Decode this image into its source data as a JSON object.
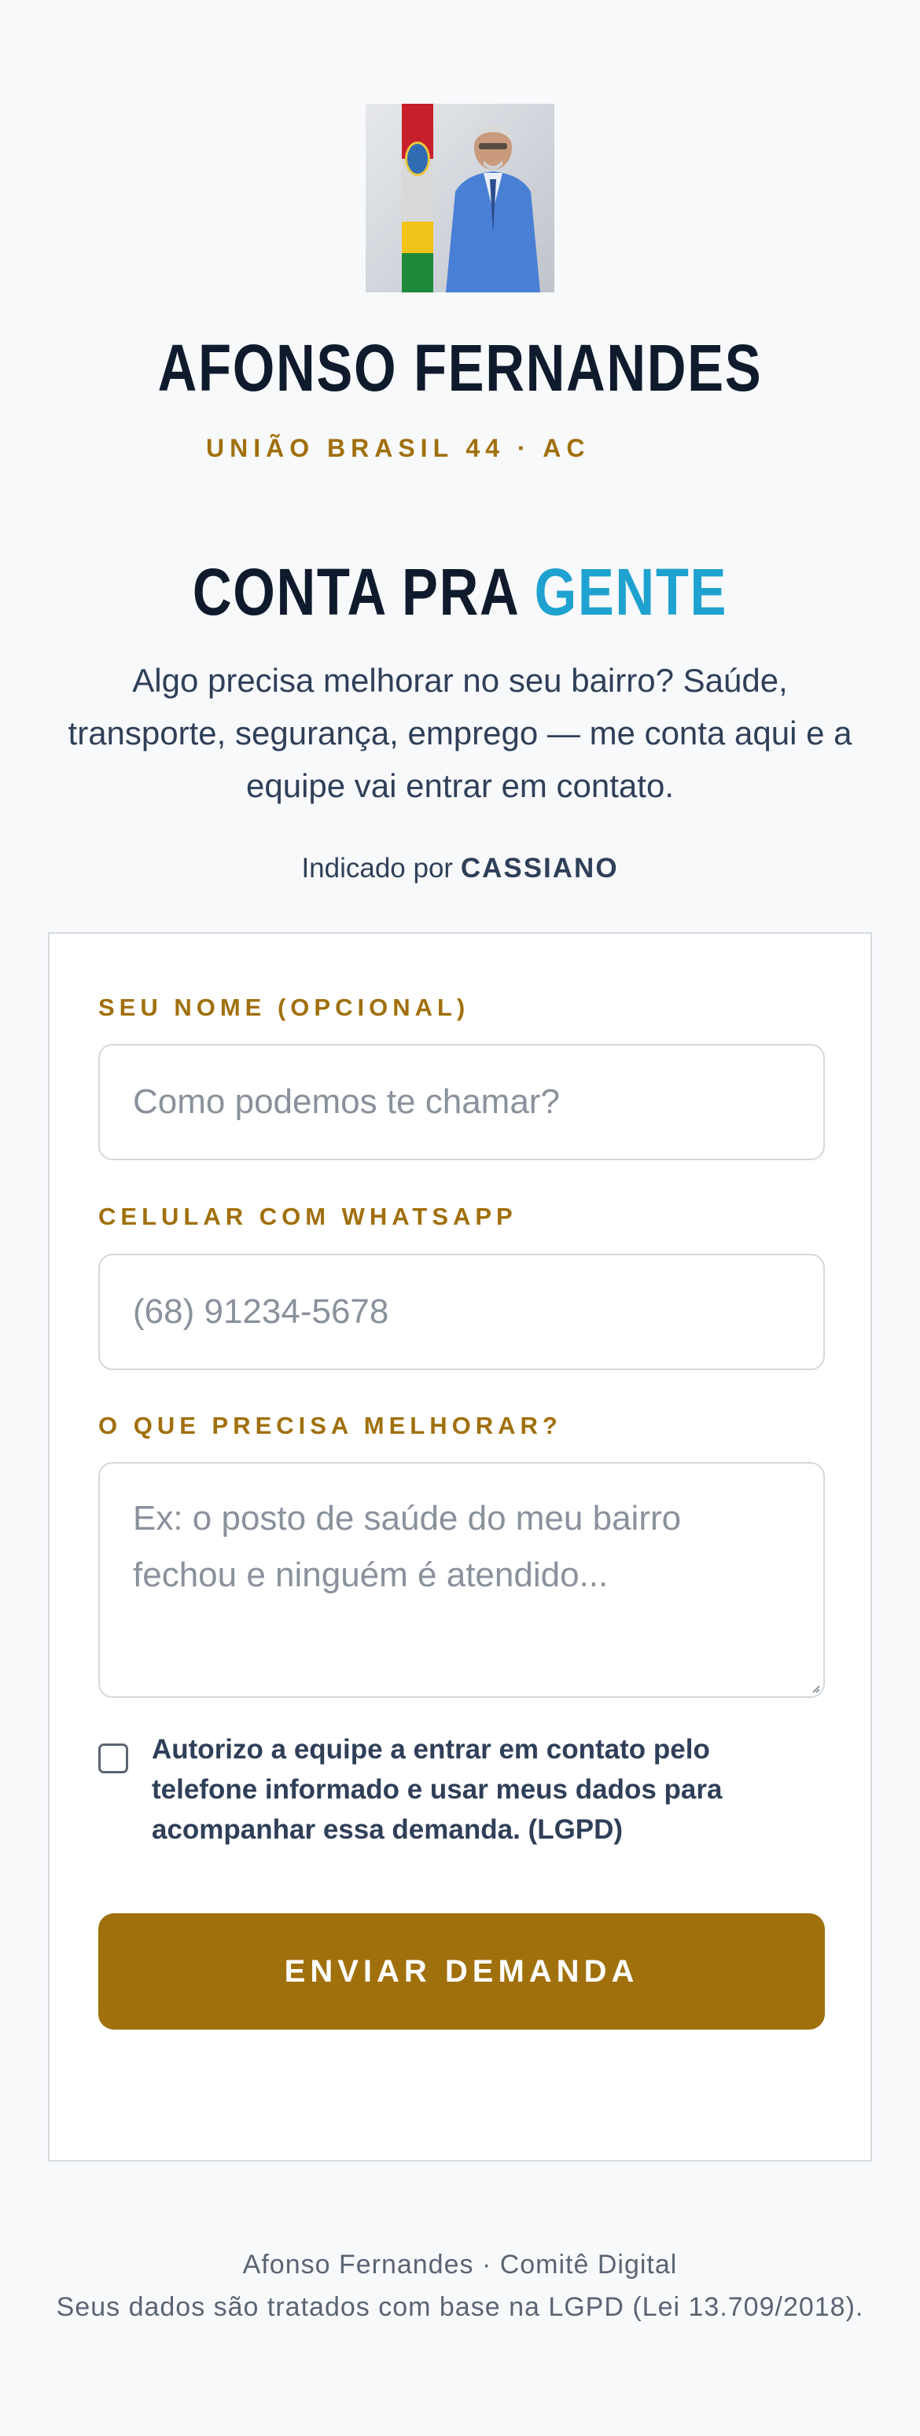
{
  "candidate": {
    "name": "AFONSO FERNANDES",
    "party": "UNIÃO BRASIL 44 · AC"
  },
  "hero": {
    "headline_main": "CONTA PRA ",
    "headline_accent": "GENTE",
    "intro": "Algo precisa melhorar no seu bairro? Saúde, transporte, segurança, emprego — me conta aqui e a equipe vai entrar em contato.",
    "referral_prefix": "Indicado por ",
    "referral_name": "CASSIANO"
  },
  "form": {
    "name_label": "SEU NOME (OPCIONAL)",
    "name_placeholder": "Como podemos te chamar?",
    "phone_label": "CELULAR COM WHATSAPP",
    "phone_placeholder": "(68) 91234-5678",
    "need_label": "O QUE PRECISA MELHORAR?",
    "need_placeholder": "Ex: o posto de saúde do meu bairro fechou e ninguém é atendido...",
    "consent_text": "Autorizo a equipe a entrar em contato pelo telefone informado e usar meus dados para acompanhar essa demanda. (LGPD)",
    "consent_checked": false,
    "submit_label": "ENVIAR DEMANDA"
  },
  "footer": {
    "line1": "Afonso Fernandes · Comitê Digital",
    "line2": "Seus dados são tratados com base na LGPD (Lei 13.709/2018)."
  },
  "colors": {
    "accent_gold": "#a0700d",
    "accent_cyan": "#1fa2cf",
    "text_dark": "#0f1b2d",
    "background": "#f8f9fb"
  }
}
